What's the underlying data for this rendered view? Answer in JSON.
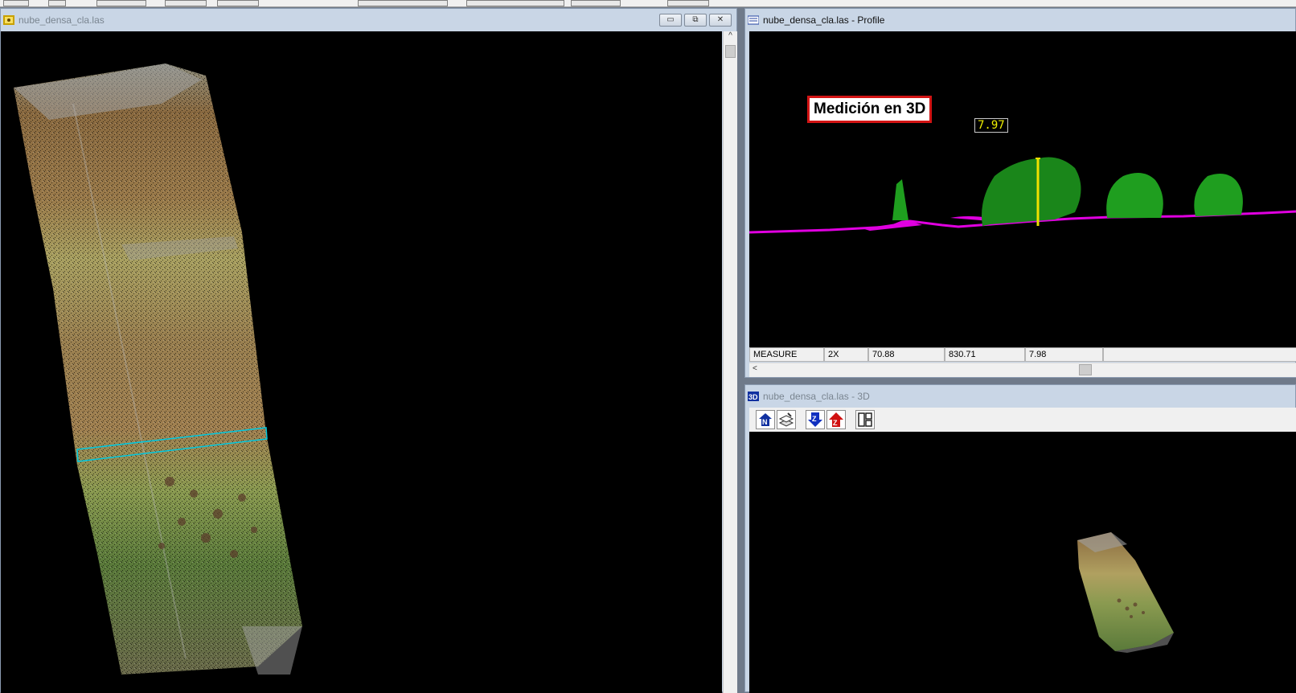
{
  "windows": {
    "plan": {
      "title": "nube_densa_cla.las",
      "buttons": {
        "minimize": "▭",
        "restore": "⧉",
        "close": "✕"
      },
      "scroll_up": "^"
    },
    "profile": {
      "title": "nube_densa_cla.las - Profile",
      "callout": "Medición en 3D",
      "measure_value": "7.97",
      "status": [
        "MEASURE",
        "2X",
        "70.88",
        "830.71",
        "7.98",
        ""
      ],
      "scroll_left": "<"
    },
    "view3d": {
      "title": "nube_densa_cla.las - 3D",
      "tools": [
        "north-up",
        "layers",
        "z-down",
        "z-up",
        "split-view"
      ]
    }
  },
  "colors": {
    "ground": "#e000e0",
    "vegetation": "#1f9e1f",
    "selection": "#00c8e0",
    "measure_line": "#f0e000",
    "callout_border": "#d21414"
  }
}
